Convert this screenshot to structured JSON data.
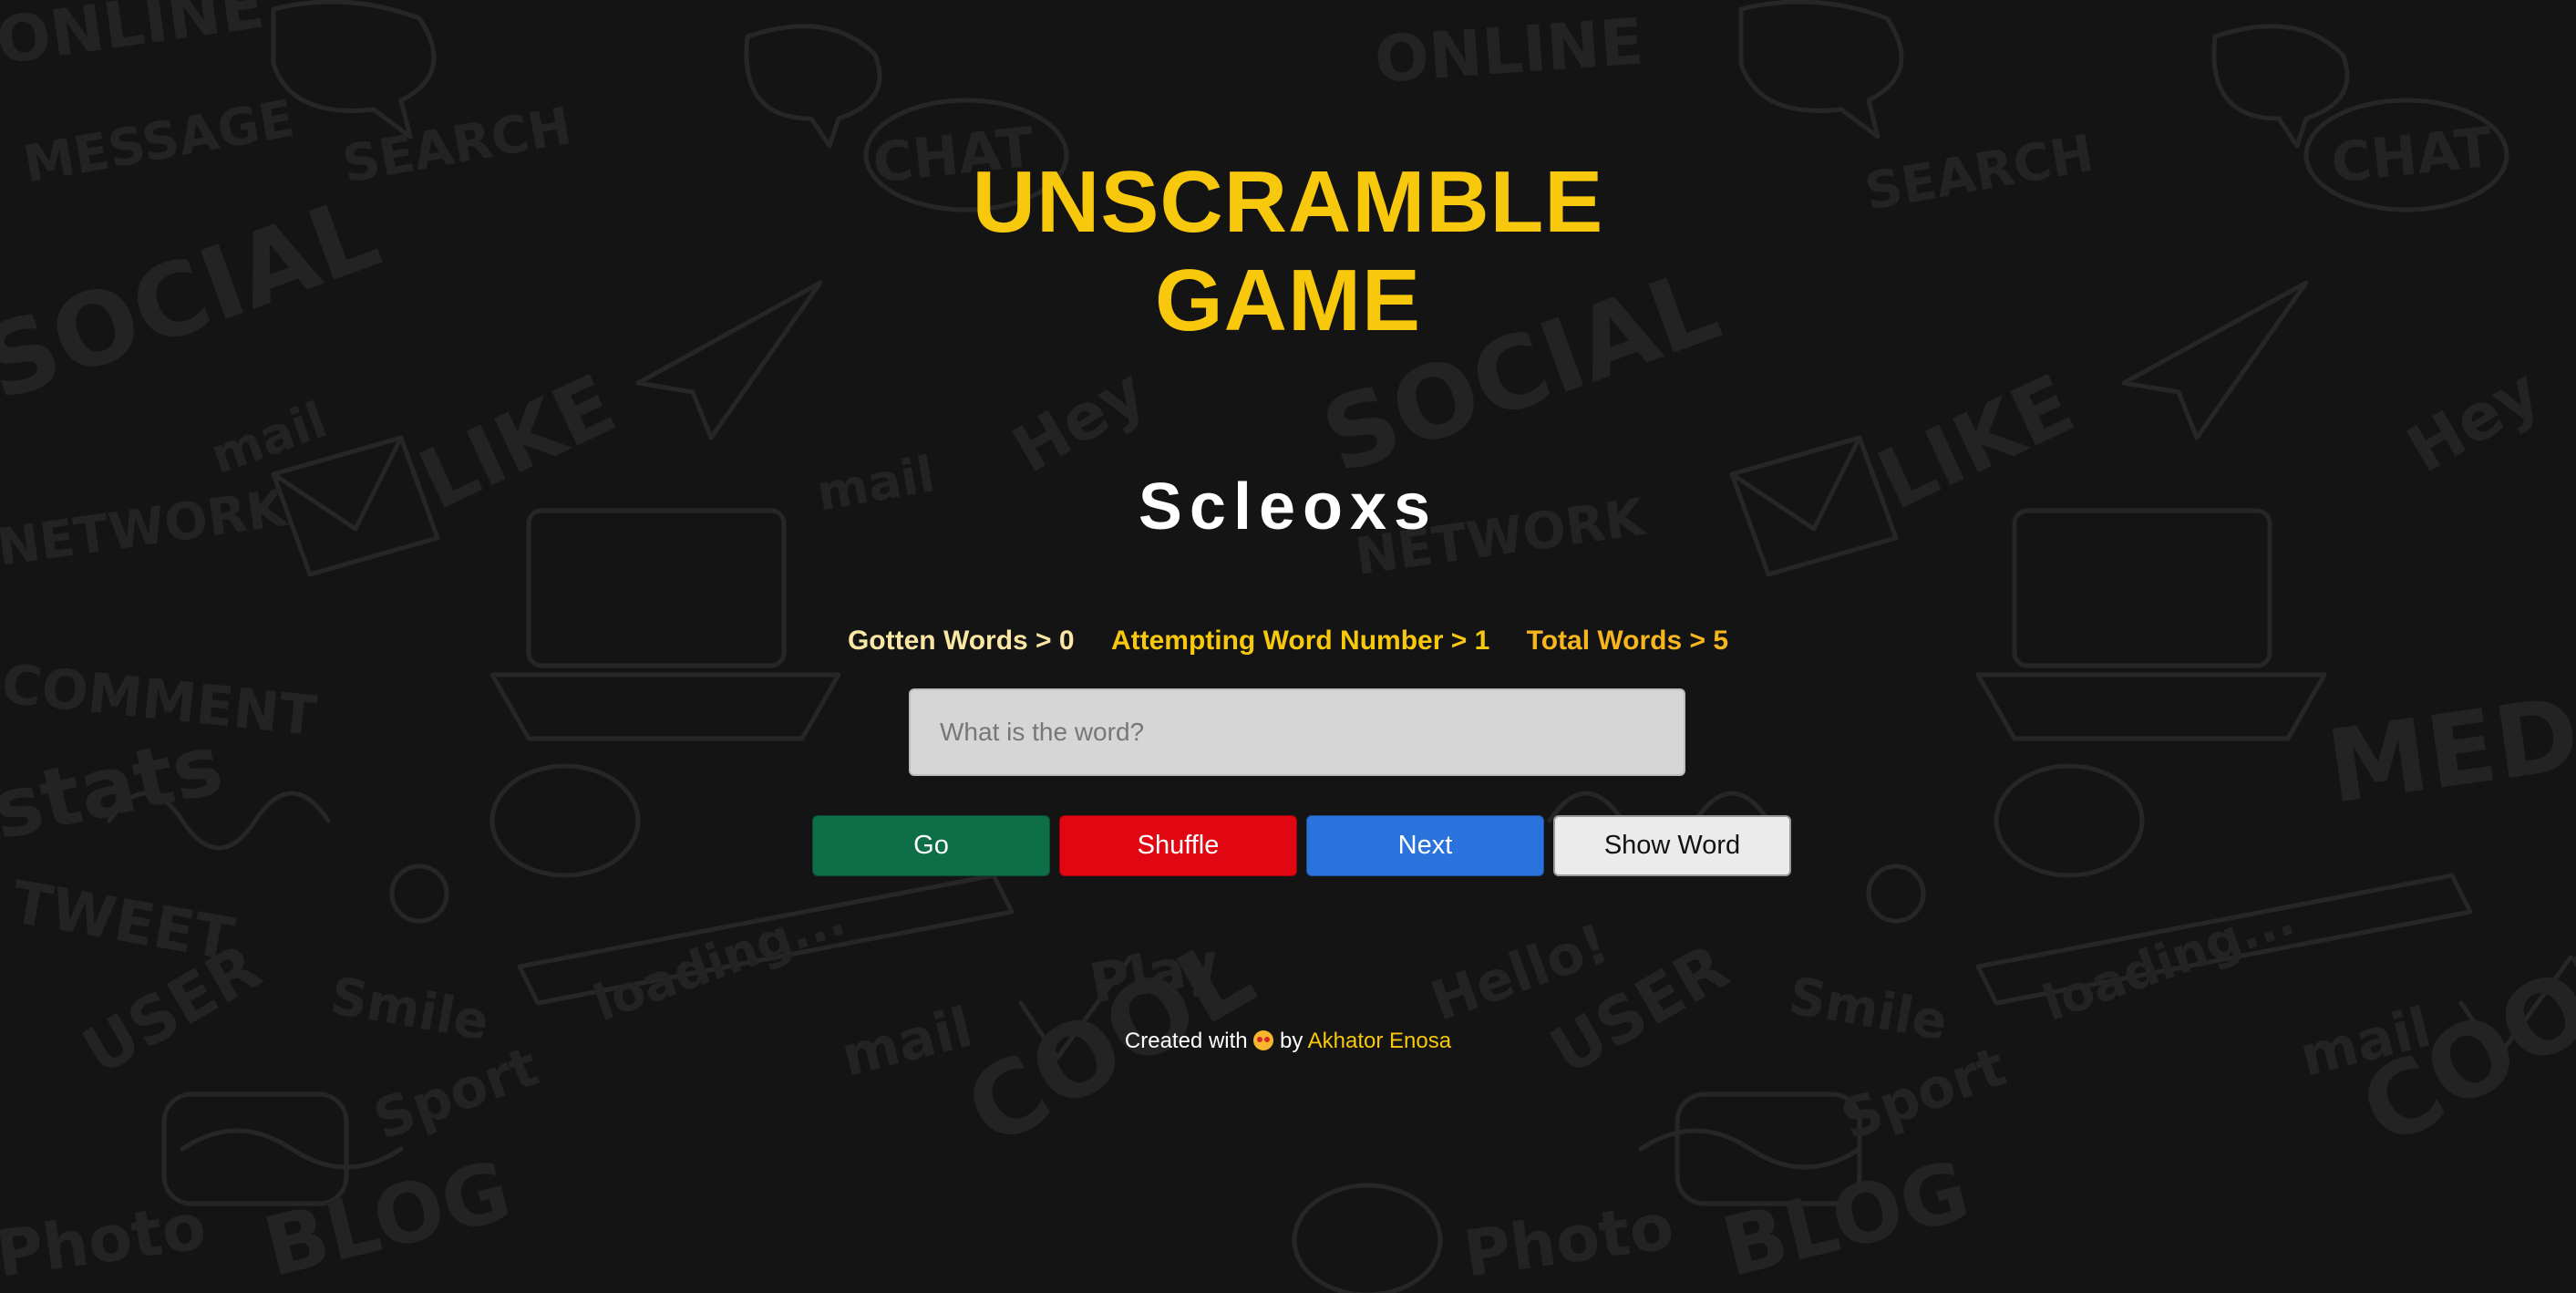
{
  "game": {
    "title_line1": "UNSCRAMBLE",
    "title_line2": "GAME",
    "scrambled_word": "Scleoxs"
  },
  "stats": {
    "gotten": "Gotten Words > 0",
    "attempting": "Attempting Word Number > 1",
    "total": "Total Words > 5"
  },
  "input": {
    "value": "",
    "placeholder": "What is the word?"
  },
  "buttons": {
    "go": "Go",
    "shuffle": "Shuffle",
    "next": "Next",
    "show_word": "Show Word"
  },
  "footer": {
    "prefix": "Created with",
    "emoji_icon": "heart-eyes-emoji",
    "by": "by",
    "author": "Akhator Enosa"
  },
  "colors": {
    "accent_yellow": "#f7c80c",
    "go_green": "#0d6e48",
    "shuffle_red": "#e00712",
    "next_blue": "#2b73dc",
    "background": "#141414"
  }
}
